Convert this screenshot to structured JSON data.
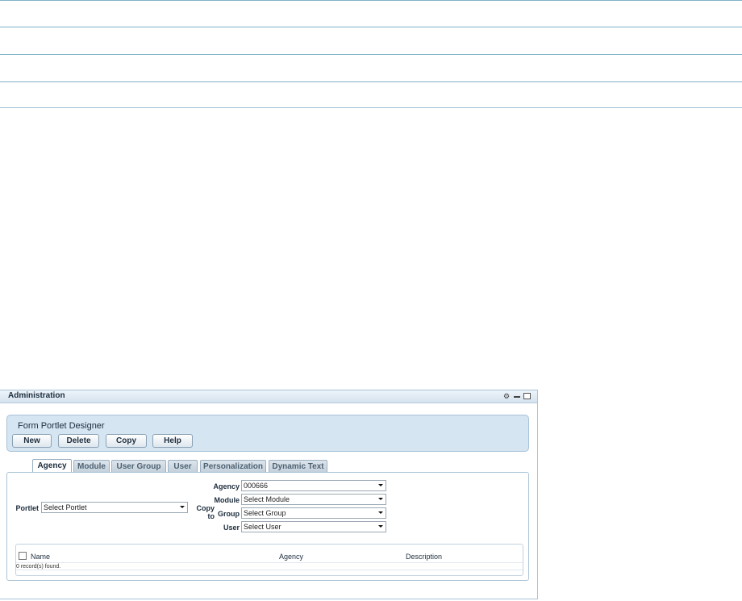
{
  "portlet": {
    "title": "Administration",
    "icons": [
      "gear-icon",
      "minimize-icon",
      "maximize-icon"
    ]
  },
  "designer": {
    "title": "Form Portlet Designer",
    "buttons": {
      "new": "New",
      "delete": "Delete",
      "copy": "Copy",
      "help": "Help"
    }
  },
  "tabs": [
    "Agency",
    "Module",
    "User Group",
    "User",
    "Personalization",
    "Dynamic Text"
  ],
  "active_tab": "Agency",
  "form": {
    "portlet_label": "Portlet",
    "portlet_value": "Select Portlet",
    "copy_to_label": "Copy to",
    "agency_label": "Agency",
    "agency_value": "000666",
    "module_label": "Module",
    "module_value": "Select Module",
    "group_label": "Group",
    "group_value": "Select Group",
    "user_label": "User",
    "user_value": "Select User"
  },
  "grid": {
    "columns": [
      "Name",
      "Agency",
      "Description"
    ],
    "records_text": "0 record(s) found."
  }
}
